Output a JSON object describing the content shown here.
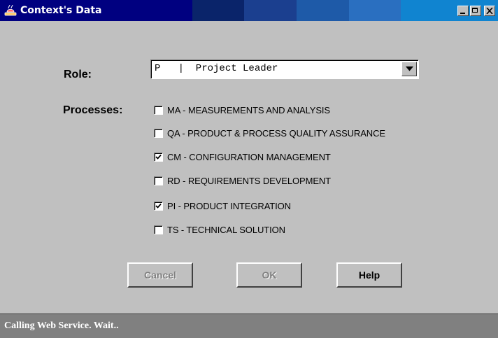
{
  "window": {
    "title": "Context's Data",
    "titlebar_colors": [
      "#000080",
      "#0a246a",
      "#1b3f8f",
      "#1e5aa8",
      "#2a6fc0",
      "#1084d0"
    ]
  },
  "form": {
    "role_label": "Role:",
    "role_selected": "P   |  Project Leader",
    "processes_label": "Processes:",
    "processes": [
      {
        "label": "MA - MEASUREMENTS AND ANALYSIS",
        "checked": false
      },
      {
        "label": "QA - PRODUCT & PROCESS QUALITY ASSURANCE",
        "checked": false
      },
      {
        "label": "CM - CONFIGURATION MANAGEMENT",
        "checked": true
      },
      {
        "label": "RD - REQUIREMENTS DEVELOPMENT",
        "checked": false
      },
      {
        "label": "PI - PRODUCT INTEGRATION",
        "checked": true
      },
      {
        "label": "TS - TECHNICAL SOLUTION",
        "checked": false
      }
    ]
  },
  "buttons": {
    "cancel": {
      "label": "Cancel",
      "enabled": false
    },
    "ok": {
      "label": "OK",
      "enabled": false
    },
    "help": {
      "label": "Help",
      "enabled": true
    }
  },
  "status": {
    "text": "Calling Web Service. Wait.."
  }
}
